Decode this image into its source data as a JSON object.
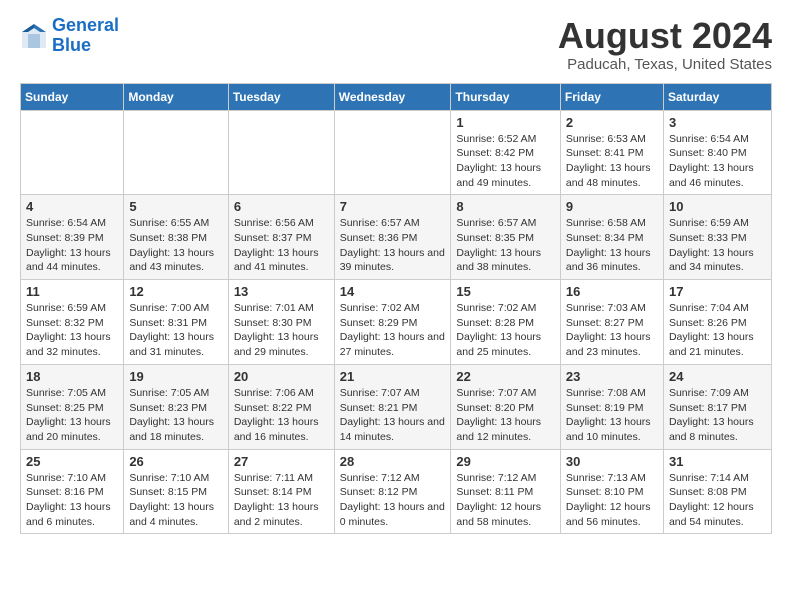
{
  "header": {
    "logo_line1": "General",
    "logo_line2": "Blue",
    "main_title": "August 2024",
    "subtitle": "Paducah, Texas, United States"
  },
  "days_of_week": [
    "Sunday",
    "Monday",
    "Tuesday",
    "Wednesday",
    "Thursday",
    "Friday",
    "Saturday"
  ],
  "weeks": [
    [
      {
        "date": "",
        "sunrise": "",
        "sunset": "",
        "daylight": ""
      },
      {
        "date": "",
        "sunrise": "",
        "sunset": "",
        "daylight": ""
      },
      {
        "date": "",
        "sunrise": "",
        "sunset": "",
        "daylight": ""
      },
      {
        "date": "",
        "sunrise": "",
        "sunset": "",
        "daylight": ""
      },
      {
        "date": "1",
        "sunrise": "Sunrise: 6:52 AM",
        "sunset": "Sunset: 8:42 PM",
        "daylight": "Daylight: 13 hours and 49 minutes."
      },
      {
        "date": "2",
        "sunrise": "Sunrise: 6:53 AM",
        "sunset": "Sunset: 8:41 PM",
        "daylight": "Daylight: 13 hours and 48 minutes."
      },
      {
        "date": "3",
        "sunrise": "Sunrise: 6:54 AM",
        "sunset": "Sunset: 8:40 PM",
        "daylight": "Daylight: 13 hours and 46 minutes."
      }
    ],
    [
      {
        "date": "4",
        "sunrise": "Sunrise: 6:54 AM",
        "sunset": "Sunset: 8:39 PM",
        "daylight": "Daylight: 13 hours and 44 minutes."
      },
      {
        "date": "5",
        "sunrise": "Sunrise: 6:55 AM",
        "sunset": "Sunset: 8:38 PM",
        "daylight": "Daylight: 13 hours and 43 minutes."
      },
      {
        "date": "6",
        "sunrise": "Sunrise: 6:56 AM",
        "sunset": "Sunset: 8:37 PM",
        "daylight": "Daylight: 13 hours and 41 minutes."
      },
      {
        "date": "7",
        "sunrise": "Sunrise: 6:57 AM",
        "sunset": "Sunset: 8:36 PM",
        "daylight": "Daylight: 13 hours and 39 minutes."
      },
      {
        "date": "8",
        "sunrise": "Sunrise: 6:57 AM",
        "sunset": "Sunset: 8:35 PM",
        "daylight": "Daylight: 13 hours and 38 minutes."
      },
      {
        "date": "9",
        "sunrise": "Sunrise: 6:58 AM",
        "sunset": "Sunset: 8:34 PM",
        "daylight": "Daylight: 13 hours and 36 minutes."
      },
      {
        "date": "10",
        "sunrise": "Sunrise: 6:59 AM",
        "sunset": "Sunset: 8:33 PM",
        "daylight": "Daylight: 13 hours and 34 minutes."
      }
    ],
    [
      {
        "date": "11",
        "sunrise": "Sunrise: 6:59 AM",
        "sunset": "Sunset: 8:32 PM",
        "daylight": "Daylight: 13 hours and 32 minutes."
      },
      {
        "date": "12",
        "sunrise": "Sunrise: 7:00 AM",
        "sunset": "Sunset: 8:31 PM",
        "daylight": "Daylight: 13 hours and 31 minutes."
      },
      {
        "date": "13",
        "sunrise": "Sunrise: 7:01 AM",
        "sunset": "Sunset: 8:30 PM",
        "daylight": "Daylight: 13 hours and 29 minutes."
      },
      {
        "date": "14",
        "sunrise": "Sunrise: 7:02 AM",
        "sunset": "Sunset: 8:29 PM",
        "daylight": "Daylight: 13 hours and 27 minutes."
      },
      {
        "date": "15",
        "sunrise": "Sunrise: 7:02 AM",
        "sunset": "Sunset: 8:28 PM",
        "daylight": "Daylight: 13 hours and 25 minutes."
      },
      {
        "date": "16",
        "sunrise": "Sunrise: 7:03 AM",
        "sunset": "Sunset: 8:27 PM",
        "daylight": "Daylight: 13 hours and 23 minutes."
      },
      {
        "date": "17",
        "sunrise": "Sunrise: 7:04 AM",
        "sunset": "Sunset: 8:26 PM",
        "daylight": "Daylight: 13 hours and 21 minutes."
      }
    ],
    [
      {
        "date": "18",
        "sunrise": "Sunrise: 7:05 AM",
        "sunset": "Sunset: 8:25 PM",
        "daylight": "Daylight: 13 hours and 20 minutes."
      },
      {
        "date": "19",
        "sunrise": "Sunrise: 7:05 AM",
        "sunset": "Sunset: 8:23 PM",
        "daylight": "Daylight: 13 hours and 18 minutes."
      },
      {
        "date": "20",
        "sunrise": "Sunrise: 7:06 AM",
        "sunset": "Sunset: 8:22 PM",
        "daylight": "Daylight: 13 hours and 16 minutes."
      },
      {
        "date": "21",
        "sunrise": "Sunrise: 7:07 AM",
        "sunset": "Sunset: 8:21 PM",
        "daylight": "Daylight: 13 hours and 14 minutes."
      },
      {
        "date": "22",
        "sunrise": "Sunrise: 7:07 AM",
        "sunset": "Sunset: 8:20 PM",
        "daylight": "Daylight: 13 hours and 12 minutes."
      },
      {
        "date": "23",
        "sunrise": "Sunrise: 7:08 AM",
        "sunset": "Sunset: 8:19 PM",
        "daylight": "Daylight: 13 hours and 10 minutes."
      },
      {
        "date": "24",
        "sunrise": "Sunrise: 7:09 AM",
        "sunset": "Sunset: 8:17 PM",
        "daylight": "Daylight: 13 hours and 8 minutes."
      }
    ],
    [
      {
        "date": "25",
        "sunrise": "Sunrise: 7:10 AM",
        "sunset": "Sunset: 8:16 PM",
        "daylight": "Daylight: 13 hours and 6 minutes."
      },
      {
        "date": "26",
        "sunrise": "Sunrise: 7:10 AM",
        "sunset": "Sunset: 8:15 PM",
        "daylight": "Daylight: 13 hours and 4 minutes."
      },
      {
        "date": "27",
        "sunrise": "Sunrise: 7:11 AM",
        "sunset": "Sunset: 8:14 PM",
        "daylight": "Daylight: 13 hours and 2 minutes."
      },
      {
        "date": "28",
        "sunrise": "Sunrise: 7:12 AM",
        "sunset": "Sunset: 8:12 PM",
        "daylight": "Daylight: 13 hours and 0 minutes."
      },
      {
        "date": "29",
        "sunrise": "Sunrise: 7:12 AM",
        "sunset": "Sunset: 8:11 PM",
        "daylight": "Daylight: 12 hours and 58 minutes."
      },
      {
        "date": "30",
        "sunrise": "Sunrise: 7:13 AM",
        "sunset": "Sunset: 8:10 PM",
        "daylight": "Daylight: 12 hours and 56 minutes."
      },
      {
        "date": "31",
        "sunrise": "Sunrise: 7:14 AM",
        "sunset": "Sunset: 8:08 PM",
        "daylight": "Daylight: 12 hours and 54 minutes."
      }
    ]
  ]
}
